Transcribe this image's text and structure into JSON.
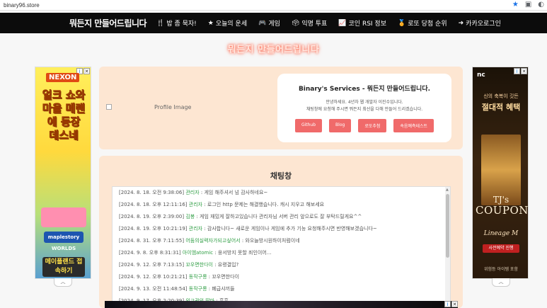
{
  "browser": {
    "url": "binary96.store"
  },
  "nav": {
    "brand": "뭐든지 만들어드립니다",
    "items": [
      {
        "icon": "utensils-icon",
        "glyph": "🍴",
        "label": "밥 좀 묵자!"
      },
      {
        "icon": "star-icon",
        "glyph": "★",
        "label": "오늘의 운세"
      },
      {
        "icon": "gamepad-icon",
        "glyph": "🎮",
        "label": "게임"
      },
      {
        "icon": "vote-icon",
        "glyph": "🗳",
        "label": "익명 투표"
      },
      {
        "icon": "chart-icon",
        "glyph": "📈",
        "label": "코인 RSI 정보"
      },
      {
        "icon": "medal-icon",
        "glyph": "🏅",
        "label": "로또 당첨 순위"
      },
      {
        "icon": "login-icon",
        "glyph": "➜",
        "label": "카카오로그인"
      }
    ]
  },
  "hero": {
    "title": "뭐든지 만들어드립니다"
  },
  "ads": {
    "left": {
      "brand": "NEXON",
      "headline": "얼크 쇼와마을 메랜에 등장 데스네",
      "worlds": "maplestory WORLDS",
      "cta": "메이플랜드 접속하기"
    },
    "right": {
      "brand": "nc",
      "tagline": "신의 축복이 깃든",
      "title": "절대적 혜택",
      "coupon_line1": "TJ's",
      "coupon_line2": "COUPON",
      "game": "Lineage M",
      "button": "사전예약 진행",
      "footer": "위험등 아이템 포함"
    },
    "toggle_glyph": "︿"
  },
  "profile": {
    "image_alt": "Profile Image",
    "title": "Binary's Services - 뭐든지 만들어드립니다.",
    "desc_line1": "안녕하세요. 4년차 웹 개발자 이진수입니다.",
    "desc_line2": "채팅창에 요청해 주시면 뭐든지 최선을 다해 만들어 드리겠습니다.",
    "buttons": [
      "Github",
      "Blog",
      "로또추첨",
      "속음예측테스트"
    ]
  },
  "chat": {
    "title": "채팅창",
    "messages": [
      {
        "time": "[2024. 8. 18. 오전 9:38:06]",
        "user": "관리자",
        "text": ": 게임 해주셔서 넘 감사하네요~"
      },
      {
        "time": "[2024. 8. 18. 오후 12:11:16]",
        "user": "관리자",
        "text": ": 로그인 http 문제는 해결했습니다. 캐시 지우고 해보세요"
      },
      {
        "time": "[2024. 8. 19. 오후 2:39:00]",
        "user": "김봉",
        "text": ": 게임 재밌게 잘하고있습니다 관리자님 서버 관리 앞으로도 잘 부탁드릴게요^^"
      },
      {
        "time": "[2024. 8. 19. 오후 10:21:19]",
        "user": "관리자",
        "text": ": 감사합니다~ 새로운 게임이나 게임에 추가 기능 요청해주시면 반영해보겠습니다~"
      },
      {
        "time": "[2024. 8. 31. 오후 7:11:55]",
        "user": "어둠의실력자가되고싶어서",
        "text": ": 와오늘방시원하이처럼이네"
      },
      {
        "time": "[2024. 9. 8. 오후 8:31:31]",
        "user": "아이엠atomic",
        "text": ": 웅서방지 못할 죄인이어..."
      },
      {
        "time": "[2024. 9. 12. 오후 7:13:15]",
        "user": "꼬우면한다이",
        "text": ": 유령결입?"
      },
      {
        "time": "[2024. 9. 12. 오후 10:21:21]",
        "user": "동작구롱",
        "text": ": 꼬우면한다이"
      },
      {
        "time": "[2024. 9. 13. 오전 11:48:54]",
        "user": "동작구롱",
        "text": ": 폐급샤끼들"
      },
      {
        "time": "[2024. 9. 17. 오후 2:20:39]",
        "user": "외교관의 딸마",
        "text": ": 흠흠"
      }
    ]
  },
  "colors": {
    "nav_bg": "#0c0c0c",
    "card_bg": "#fde6d2",
    "button_bg": "#f06a6a",
    "username": "#2f9e44"
  }
}
